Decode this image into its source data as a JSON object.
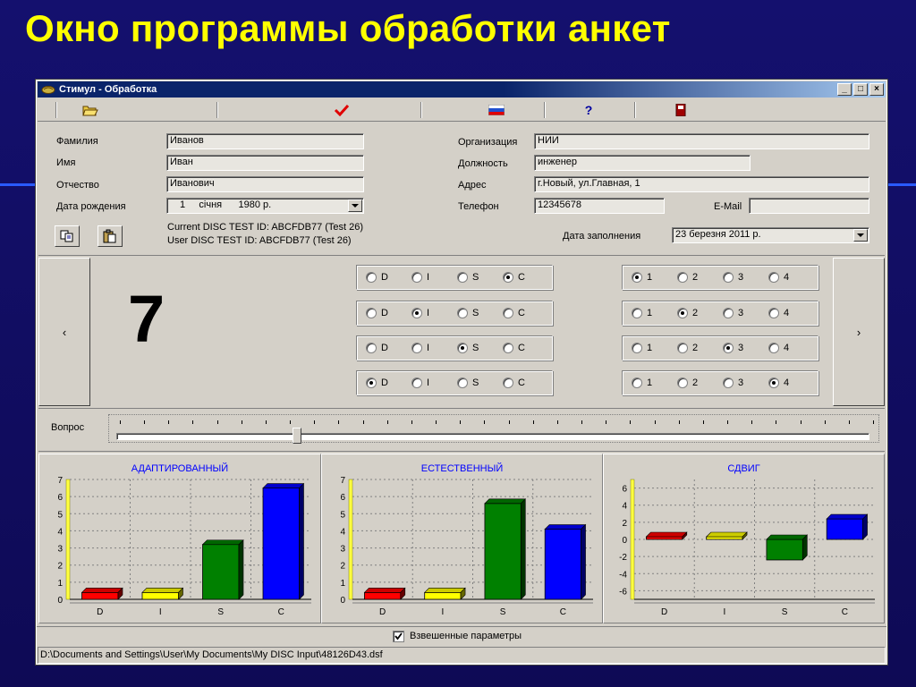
{
  "slide": {
    "title": "Окно программы обработки анкет"
  },
  "window": {
    "title": "Стимул - Обработка",
    "controls": {
      "minimize": "_",
      "maximize": "□",
      "close": "×"
    }
  },
  "form": {
    "surname_label": "Фамилия",
    "surname": "Иванов",
    "name_label": "Имя",
    "name": "Иван",
    "patronymic_label": "Отчество",
    "patronymic": "Иванович",
    "birth_label": "Дата рождения",
    "birth_day": "1",
    "birth_month": "січня",
    "birth_year": "1980 р.",
    "org_label": "Организация",
    "org": "НИИ",
    "position_label": "Должность",
    "position": "инженер",
    "address_label": "Адрес",
    "address": "г.Новый, ул.Главная, 1",
    "phone_label": "Телефон",
    "phone": "12345678",
    "email_label": "E-Mail",
    "email": "",
    "current_id": "Current DISC TEST ID: ABCFDB77 (Test 26)",
    "user_id": "User DISC TEST ID: ABCFDB77 (Test 26)",
    "fill_date_label": "Дата заполнения",
    "fill_date": "23  березня  2011 р."
  },
  "question": {
    "number": "7",
    "prev": "‹",
    "next": "›",
    "letters": [
      "D",
      "I",
      "S",
      "C"
    ],
    "ranks": [
      "1",
      "2",
      "3",
      "4"
    ],
    "rows": [
      {
        "letter": "C",
        "rank": "1"
      },
      {
        "letter": "I",
        "rank": "2"
      },
      {
        "letter": "S",
        "rank": "3"
      },
      {
        "letter": "D",
        "rank": "4"
      }
    ],
    "slider_label": "Вопрос",
    "slider_position": 0.24
  },
  "weighted_label": "Взвешенные параметры",
  "weighted_checked": true,
  "status_path": "D:\\Documents and Settings\\User\\My Documents\\My DISC Input\\48126D43.dsf",
  "colors": {
    "D": "#ff0000",
    "I": "#ffff00",
    "S": "#008000",
    "C": "#0000ff",
    "title": "#ffff00",
    "chart_title": "#0000ff"
  },
  "chart_data": [
    {
      "type": "bar",
      "title": "АДАПТИРОВАННЫЙ",
      "categories": [
        "D",
        "I",
        "S",
        "C"
      ],
      "values": [
        0.4,
        0.4,
        3.2,
        6.5
      ],
      "ylim": [
        0,
        7
      ],
      "yticks": [
        0,
        1,
        2,
        3,
        4,
        5,
        6,
        7
      ],
      "grid": true
    },
    {
      "type": "bar",
      "title": "ЕСТЕСТВЕННЫЙ",
      "categories": [
        "D",
        "I",
        "S",
        "C"
      ],
      "values": [
        0.4,
        0.4,
        5.6,
        4.1
      ],
      "ylim": [
        0,
        7
      ],
      "yticks": [
        0,
        1,
        2,
        3,
        4,
        5,
        6,
        7
      ],
      "grid": true
    },
    {
      "type": "bar",
      "title": "СДВИГ",
      "categories": [
        "D",
        "I",
        "S",
        "C"
      ],
      "values": [
        0,
        0,
        -2.4,
        2.4
      ],
      "ylim": [
        -7,
        7
      ],
      "yticks": [
        -6,
        -4,
        -2,
        0,
        2,
        4,
        6
      ],
      "grid": true
    }
  ]
}
